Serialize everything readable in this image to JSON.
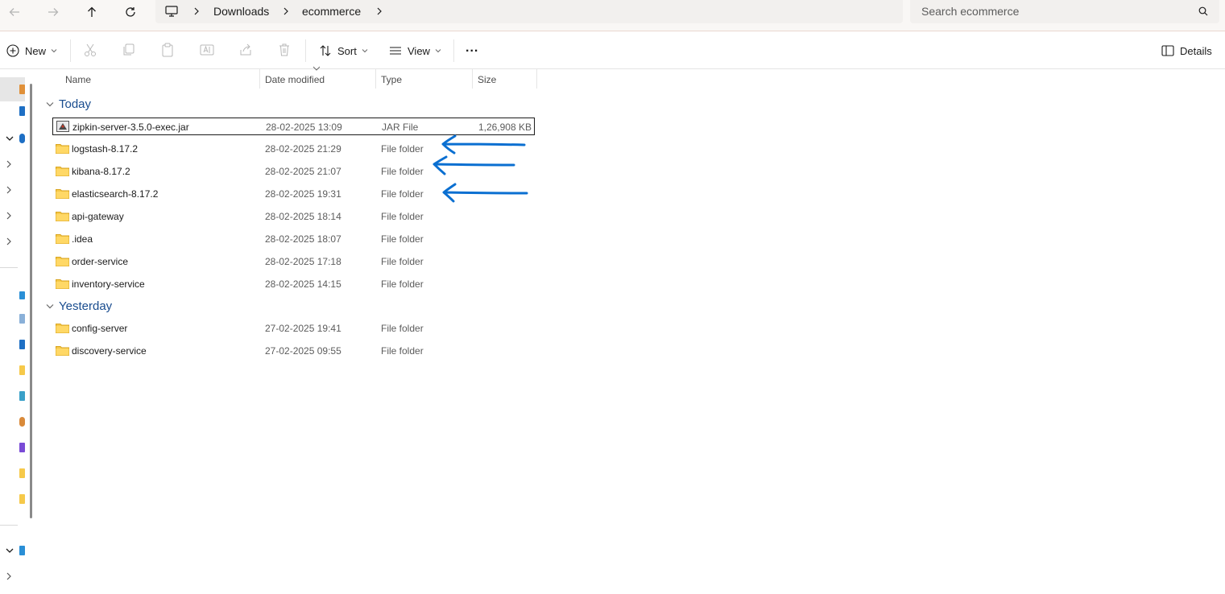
{
  "breadcrumb": [
    "Downloads",
    "ecommerce"
  ],
  "search": {
    "placeholder": "Search ecommerce"
  },
  "toolbar": {
    "new_label": "New",
    "sort_label": "Sort",
    "view_label": "View",
    "more_label": "...",
    "details_label": "Details"
  },
  "columns": {
    "name": "Name",
    "date": "Date modified",
    "type": "Type",
    "size": "Size"
  },
  "groups": [
    {
      "label": "Today",
      "items": [
        {
          "name": "zipkin-server-3.5.0-exec.jar",
          "date": "28-02-2025 13:09",
          "type": "JAR File",
          "size": "1,26,908 KB",
          "icon": "jar-file-icon",
          "selected": true
        },
        {
          "name": "logstash-8.17.2",
          "date": "28-02-2025 21:29",
          "type": "File folder",
          "size": "",
          "icon": "folder-icon"
        },
        {
          "name": "kibana-8.17.2",
          "date": "28-02-2025 21:07",
          "type": "File folder",
          "size": "",
          "icon": "folder-icon"
        },
        {
          "name": "elasticsearch-8.17.2",
          "date": "28-02-2025 19:31",
          "type": "File folder",
          "size": "",
          "icon": "folder-icon"
        },
        {
          "name": "api-gateway",
          "date": "28-02-2025 18:14",
          "type": "File folder",
          "size": "",
          "icon": "folder-icon"
        },
        {
          "name": ".idea",
          "date": "28-02-2025 18:07",
          "type": "File folder",
          "size": "",
          "icon": "folder-icon"
        },
        {
          "name": "order-service",
          "date": "28-02-2025 17:18",
          "type": "File folder",
          "size": "",
          "icon": "folder-icon"
        },
        {
          "name": "inventory-service",
          "date": "28-02-2025 14:15",
          "type": "File folder",
          "size": "",
          "icon": "folder-icon"
        }
      ]
    },
    {
      "label": "Yesterday",
      "items": [
        {
          "name": "config-server",
          "date": "27-02-2025 19:41",
          "type": "File folder",
          "size": "",
          "icon": "folder-icon"
        },
        {
          "name": "discovery-service",
          "date": "27-02-2025 09:55",
          "type": "File folder",
          "size": "",
          "icon": "folder-icon"
        }
      ]
    }
  ],
  "colors": {
    "accent": "#1a4d8f",
    "annotation_arrow": "#0a6fd1",
    "folder": "#f6c94a"
  }
}
